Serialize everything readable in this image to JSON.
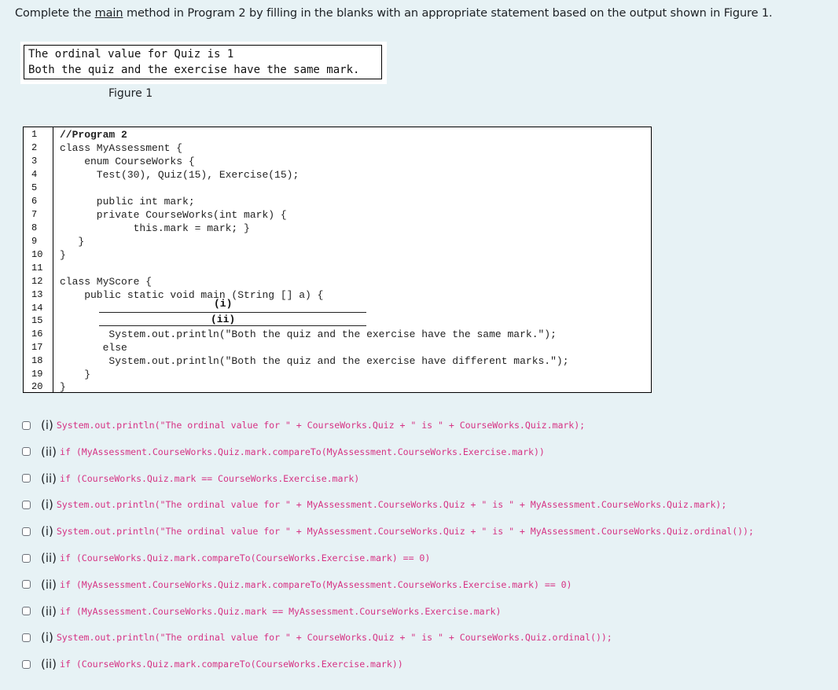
{
  "instruction": {
    "before": "Complete the ",
    "underlined": "main",
    "after": " method in Program 2 by filling in the blanks with an appropriate statement based on the output shown in Figure 1."
  },
  "figure": {
    "output_lines": [
      "The ordinal value for Quiz is 1",
      "Both the quiz and the exercise have the same mark."
    ],
    "caption": "Figure 1"
  },
  "program": {
    "line_numbers": [
      "1",
      "2",
      "3",
      "4",
      "5",
      "6",
      "7",
      "8",
      "9",
      "10",
      "11",
      "12",
      "13",
      "14",
      "15",
      "16",
      "17",
      "18",
      "19",
      "20"
    ],
    "lines": [
      "//Program 2",
      "class MyAssessment {",
      "    enum CourseWorks {",
      "      Test(30), Quiz(15), Exercise(15);",
      "",
      "      public int mark;",
      "      private CourseWorks(int mark) {",
      "            this.mark = mark; }",
      "   }",
      "}",
      "",
      "class MyScore {",
      "    public static void main (String [] a) {",
      "",
      "",
      "        System.out.println(\"Both the quiz and the exercise have the same mark.\");",
      "       else",
      "        System.out.println(\"Both the quiz and the exercise have different marks.\");",
      "    }",
      "}"
    ],
    "blanks": [
      "(i)",
      "(ii)"
    ]
  },
  "options": [
    {
      "tag": "(i)",
      "code": "System.out.println(\"The ordinal value for \" + CourseWorks.Quiz + \" is \" + CourseWorks.Quiz.mark);",
      "checked": false
    },
    {
      "tag": "(ii)",
      "code": "if (MyAssessment.CourseWorks.Quiz.mark.compareTo(MyAssessment.CourseWorks.Exercise.mark))",
      "checked": false
    },
    {
      "tag": "(ii)",
      "code": "if (CourseWorks.Quiz.mark == CourseWorks.Exercise.mark)",
      "checked": false
    },
    {
      "tag": "(i)",
      "code": "System.out.println(\"The ordinal value for \" + MyAssessment.CourseWorks.Quiz + \" is \" + MyAssessment.CourseWorks.Quiz.mark);",
      "checked": false
    },
    {
      "tag": "(i)",
      "code": "System.out.println(\"The ordinal value for \" + MyAssessment.CourseWorks.Quiz + \" is \" + MyAssessment.CourseWorks.Quiz.ordinal());",
      "checked": false
    },
    {
      "tag": "(ii)",
      "code": "if (CourseWorks.Quiz.mark.compareTo(CourseWorks.Exercise.mark) == 0)",
      "checked": false
    },
    {
      "tag": "(ii)",
      "code": "if (MyAssessment.CourseWorks.Quiz.mark.compareTo(MyAssessment.CourseWorks.Exercise.mark) == 0)",
      "checked": false
    },
    {
      "tag": "(ii)",
      "code": "if (MyAssessment.CourseWorks.Quiz.mark == MyAssessment.CourseWorks.Exercise.mark)",
      "checked": false
    },
    {
      "tag": "(i)",
      "code": "System.out.println(\"The ordinal value for \" + CourseWorks.Quiz + \" is \" + CourseWorks.Quiz.ordinal());",
      "checked": false
    },
    {
      "tag": "(ii)",
      "code": "if (CourseWorks.Quiz.mark.compareTo(CourseWorks.Exercise.mark))",
      "checked": false
    }
  ]
}
